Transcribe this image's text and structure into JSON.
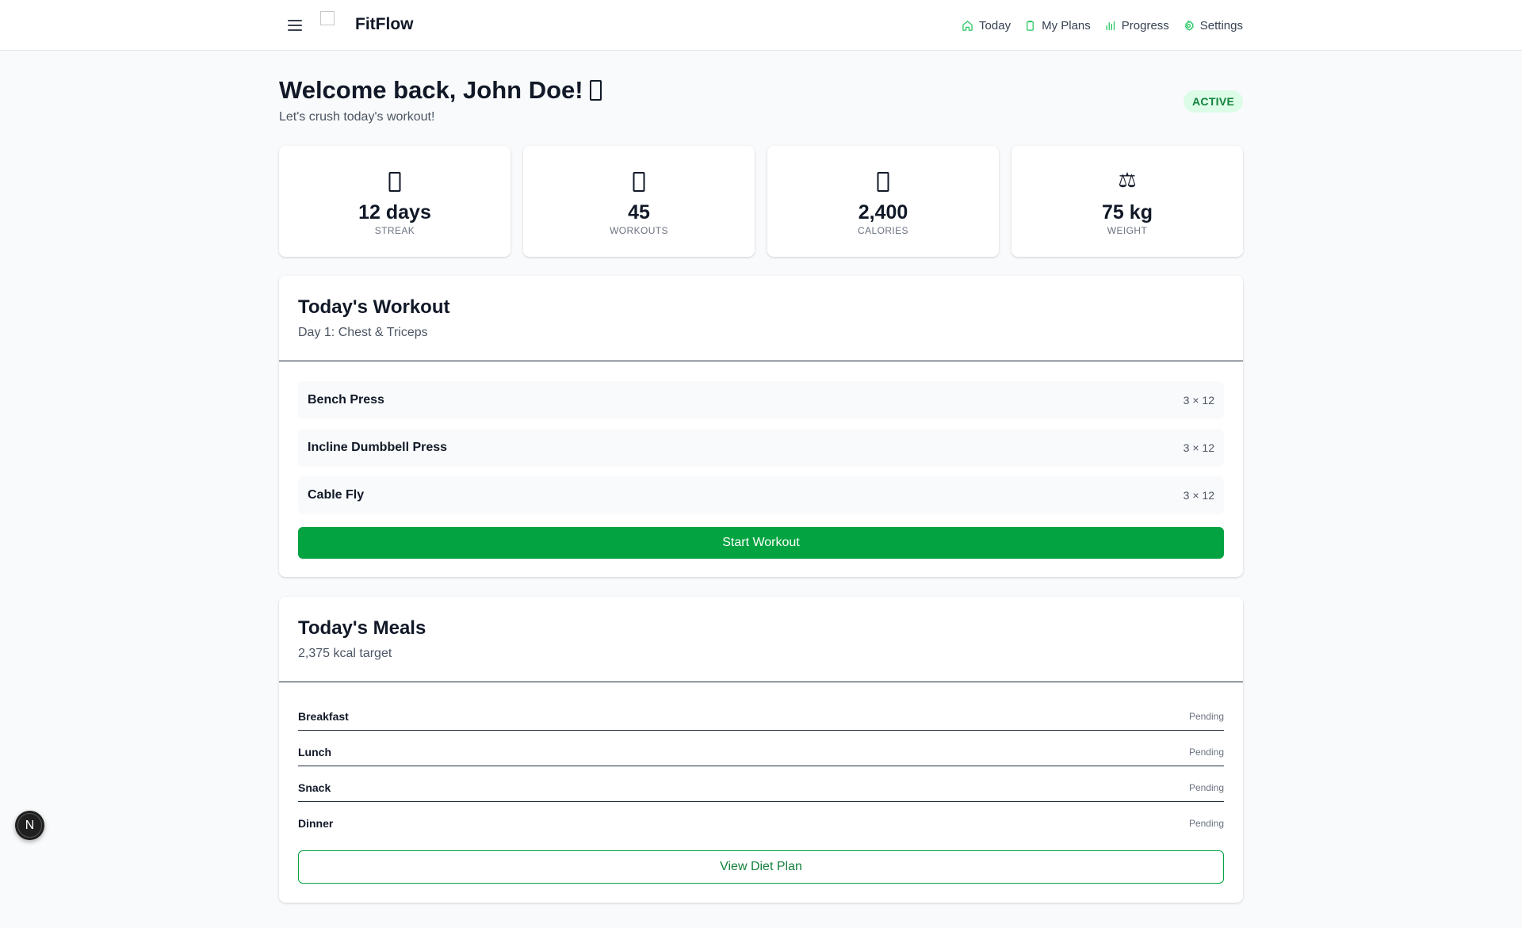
{
  "header": {
    "brand": "FitFlow",
    "nav": [
      {
        "label": "Today",
        "icon": "home-icon"
      },
      {
        "label": "My Plans",
        "icon": "clipboard-icon"
      },
      {
        "label": "Progress",
        "icon": "bar-chart-icon"
      },
      {
        "label": "Settings",
        "icon": "gear-icon"
      }
    ]
  },
  "hero": {
    "title": "Welcome back, John Doe!",
    "subtitle": "Let's crush today's workout!",
    "status": "ACTIVE"
  },
  "stats": [
    {
      "value": "12 days",
      "label": "STREAK",
      "icon": "fire-icon"
    },
    {
      "value": "45",
      "label": "WORKOUTS",
      "icon": "dumbbell-icon"
    },
    {
      "value": "2,400",
      "label": "CALORIES",
      "icon": "flame-icon"
    },
    {
      "value": "75 kg",
      "label": "WEIGHT",
      "icon": "scale-icon",
      "glyph": "⚖"
    }
  ],
  "workout": {
    "title": "Today's Workout",
    "subtitle": "Day 1: Chest & Triceps",
    "exercises": [
      {
        "name": "Bench Press",
        "sets": "3 × 12"
      },
      {
        "name": "Incline Dumbbell Press",
        "sets": "3 × 12"
      },
      {
        "name": "Cable Fly",
        "sets": "3 × 12"
      }
    ],
    "start_label": "Start Workout"
  },
  "meals": {
    "title": "Today's Meals",
    "subtitle": "2,375 kcal target",
    "items": [
      {
        "name": "Breakfast",
        "status": "Pending"
      },
      {
        "name": "Lunch",
        "status": "Pending"
      },
      {
        "name": "Snack",
        "status": "Pending"
      },
      {
        "name": "Dinner",
        "status": "Pending"
      }
    ],
    "view_label": "View Diet Plan"
  },
  "dev_badge": "N",
  "colors": {
    "accent": "#02a340",
    "badge_bg": "#dcfce7",
    "badge_text": "#15803d"
  }
}
